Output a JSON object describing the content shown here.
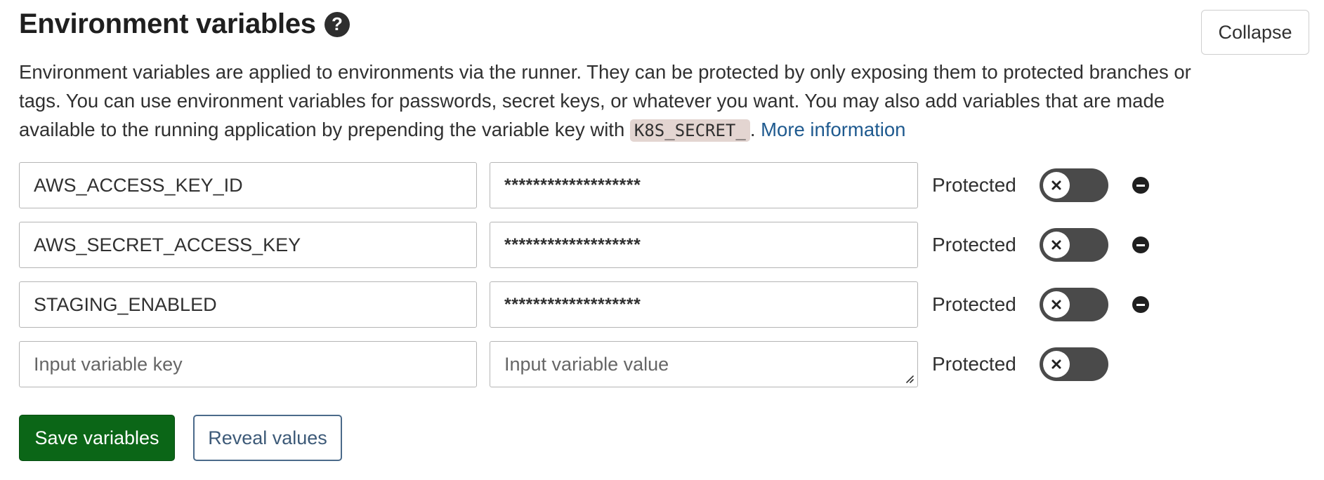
{
  "header": {
    "title": "Environment variables",
    "help_icon": "question-circle-icon",
    "collapse_label": "Collapse"
  },
  "description": {
    "text_before_code": "Environment variables are applied to environments via the runner. They can be protected by only exposing them to protected branches or tags. You can use environment variables for passwords, secret keys, or whatever you want. You may also add variables that are made available to the running application by prepending the variable key with ",
    "code": "K8S_SECRET_",
    "text_after_code": ". ",
    "link_label": "More information"
  },
  "variables": [
    {
      "key": "AWS_ACCESS_KEY_ID",
      "value": "*******************",
      "protected_label": "Protected",
      "toggle_state": "off",
      "remove_icon": "minus-circle-icon"
    },
    {
      "key": "AWS_SECRET_ACCESS_KEY",
      "value": "*******************",
      "protected_label": "Protected",
      "toggle_state": "off",
      "remove_icon": "minus-circle-icon"
    },
    {
      "key": "STAGING_ENABLED",
      "value": "*******************",
      "protected_label": "Protected",
      "toggle_state": "off",
      "remove_icon": "minus-circle-icon"
    }
  ],
  "new_variable": {
    "key_placeholder": "Input variable key",
    "value_placeholder": "Input variable value",
    "protected_label": "Protected",
    "toggle_state": "off"
  },
  "actions": {
    "save_label": "Save variables",
    "reveal_label": "Reveal values"
  },
  "colors": {
    "save_button": "#0b6617",
    "reveal_border": "#4b6a8a",
    "link": "#1f5a8f",
    "toggle_off": "#4a4a4a",
    "code_bg": "#e3d5d1"
  }
}
